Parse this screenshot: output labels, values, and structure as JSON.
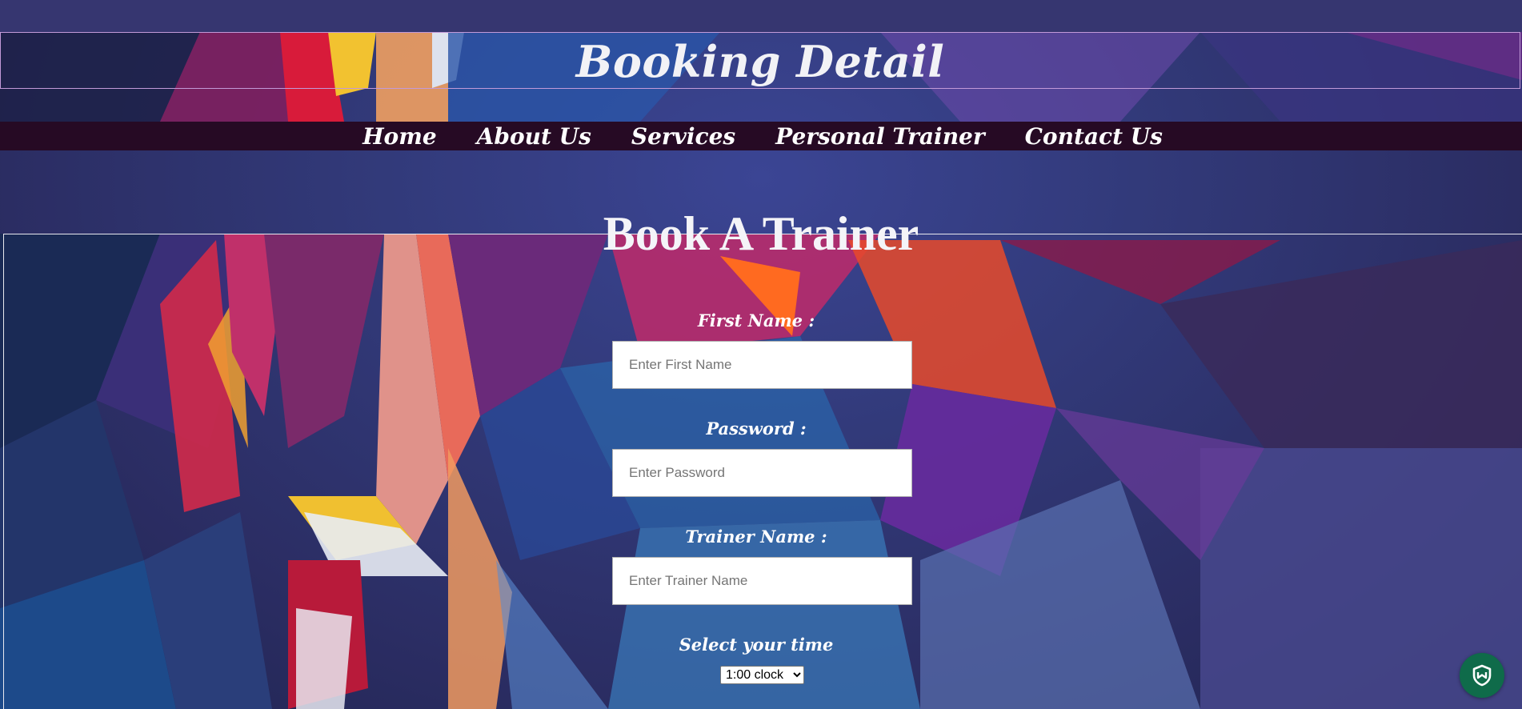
{
  "header": {
    "title": "Booking Detail"
  },
  "nav": {
    "items": [
      {
        "label": "Home"
      },
      {
        "label": "About Us"
      },
      {
        "label": "Services"
      },
      {
        "label": "Personal Trainer"
      },
      {
        "label": "Contact Us"
      }
    ]
  },
  "form": {
    "title": "Book A Trainer",
    "first_name": {
      "label": "First Name :",
      "placeholder": "Enter First Name",
      "value": ""
    },
    "password": {
      "label": "Password :",
      "placeholder": "Enter Password",
      "value": ""
    },
    "trainer_name": {
      "label": "Trainer Name :",
      "placeholder": "Enter Trainer Name",
      "value": ""
    },
    "time": {
      "label": "Select your time",
      "selected": "1:00 clock"
    }
  },
  "colors": {
    "nav_bg": "#260a24",
    "page_bg": "#2e3470",
    "header_border": "#c29ad8",
    "chat_widget": "#0f6b4a"
  },
  "icons": {
    "chat_widget": "shield-chat-icon"
  }
}
